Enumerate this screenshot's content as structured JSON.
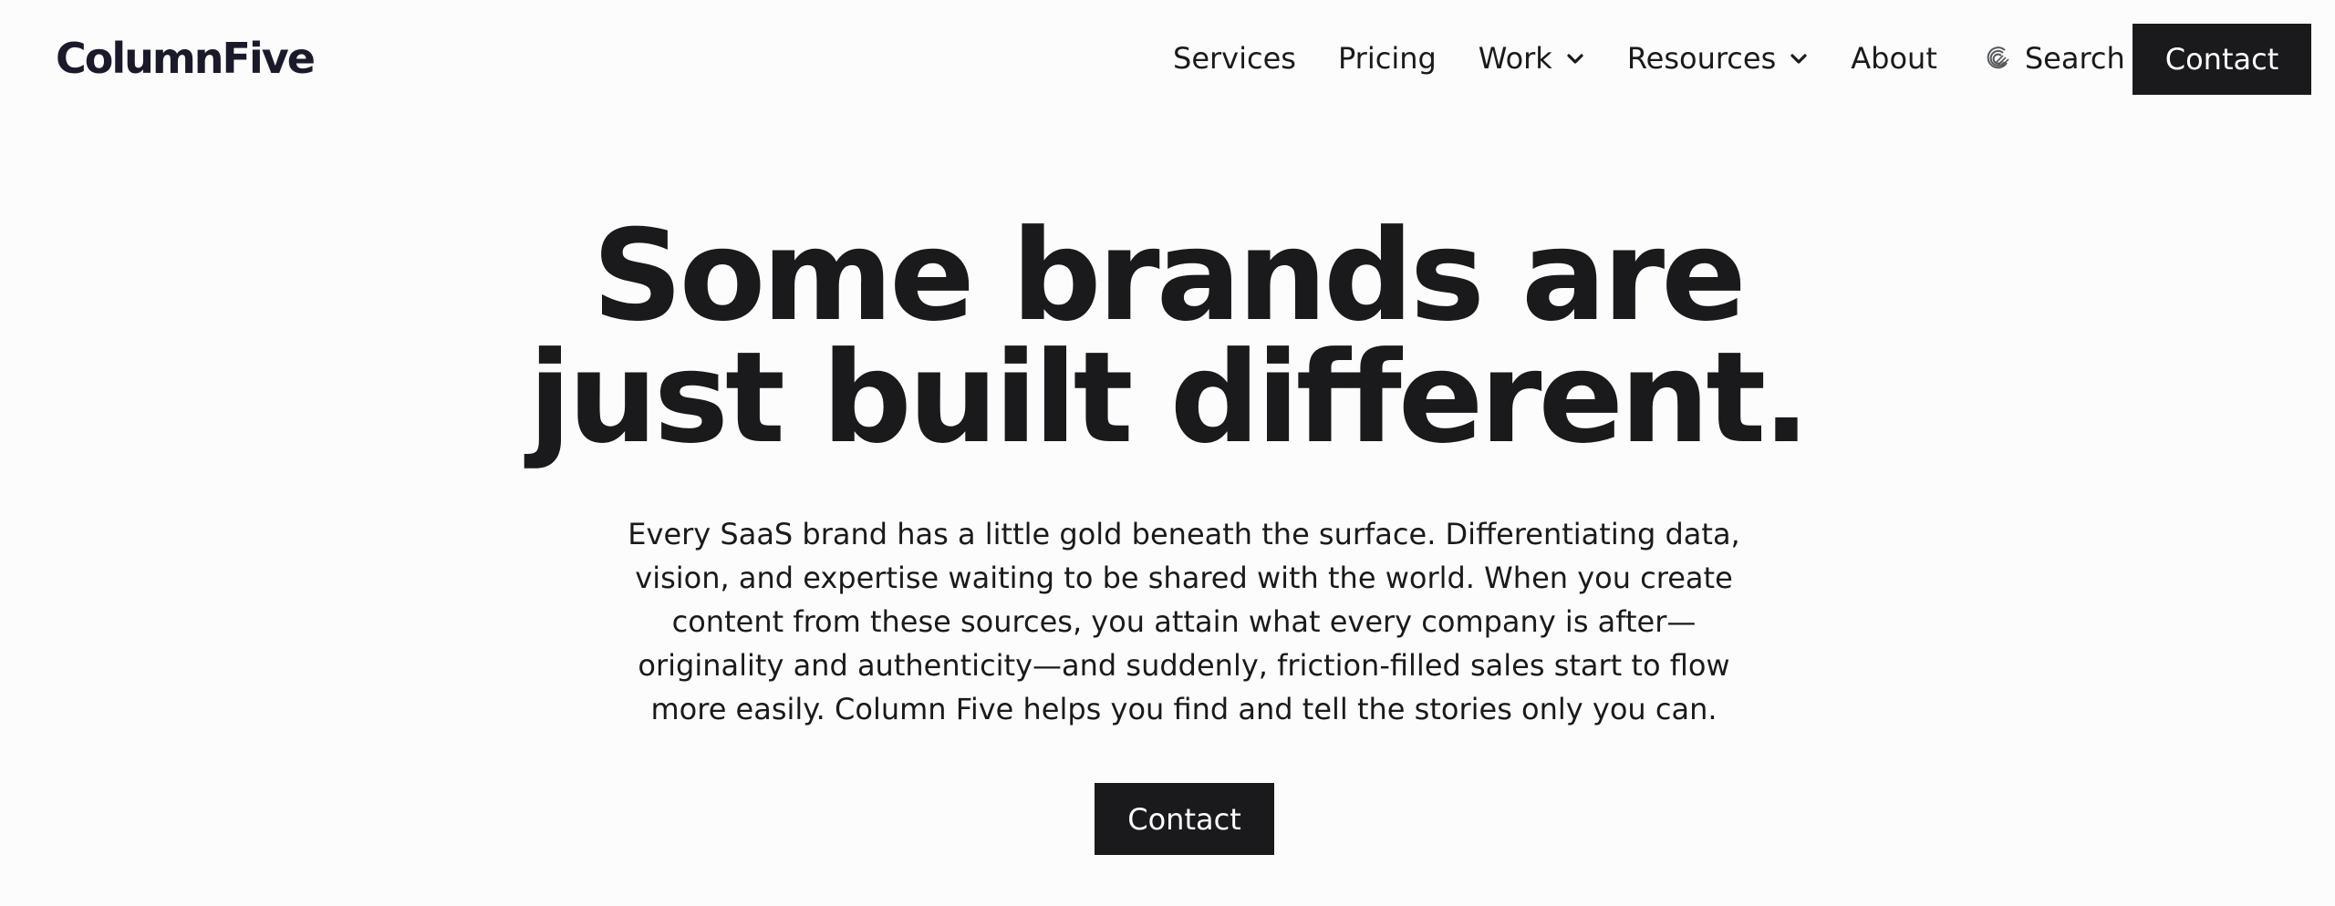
{
  "brand": {
    "logo_text": "ColumnFive"
  },
  "nav": {
    "items": [
      {
        "label": "Services"
      },
      {
        "label": "Pricing"
      },
      {
        "label": "Work",
        "has_dropdown": true
      },
      {
        "label": "Resources",
        "has_dropdown": true
      },
      {
        "label": "About"
      }
    ],
    "search_label": "Search",
    "search_icon": "search-brand-icon",
    "chevron_icon": "chevron-down-icon",
    "contact_label": "Contact"
  },
  "hero": {
    "title_line1": "Some brands are",
    "title_line2": "just built different.",
    "body": "Every SaaS brand has a little gold beneath the surface. Differentiating data, vision, and expertise waiting to be shared with the world. When you create content from these sources, you attain what every company is after—originality and authenticity—and suddenly, friction-filled sales start to flow more easily. Column Five helps you find and tell the stories only you can.",
    "cta_label": "Contact"
  },
  "colors": {
    "background": "#fcfcfc",
    "text": "#1a1a1d",
    "button_bg": "#1a1a1d",
    "button_text": "#ffffff"
  }
}
